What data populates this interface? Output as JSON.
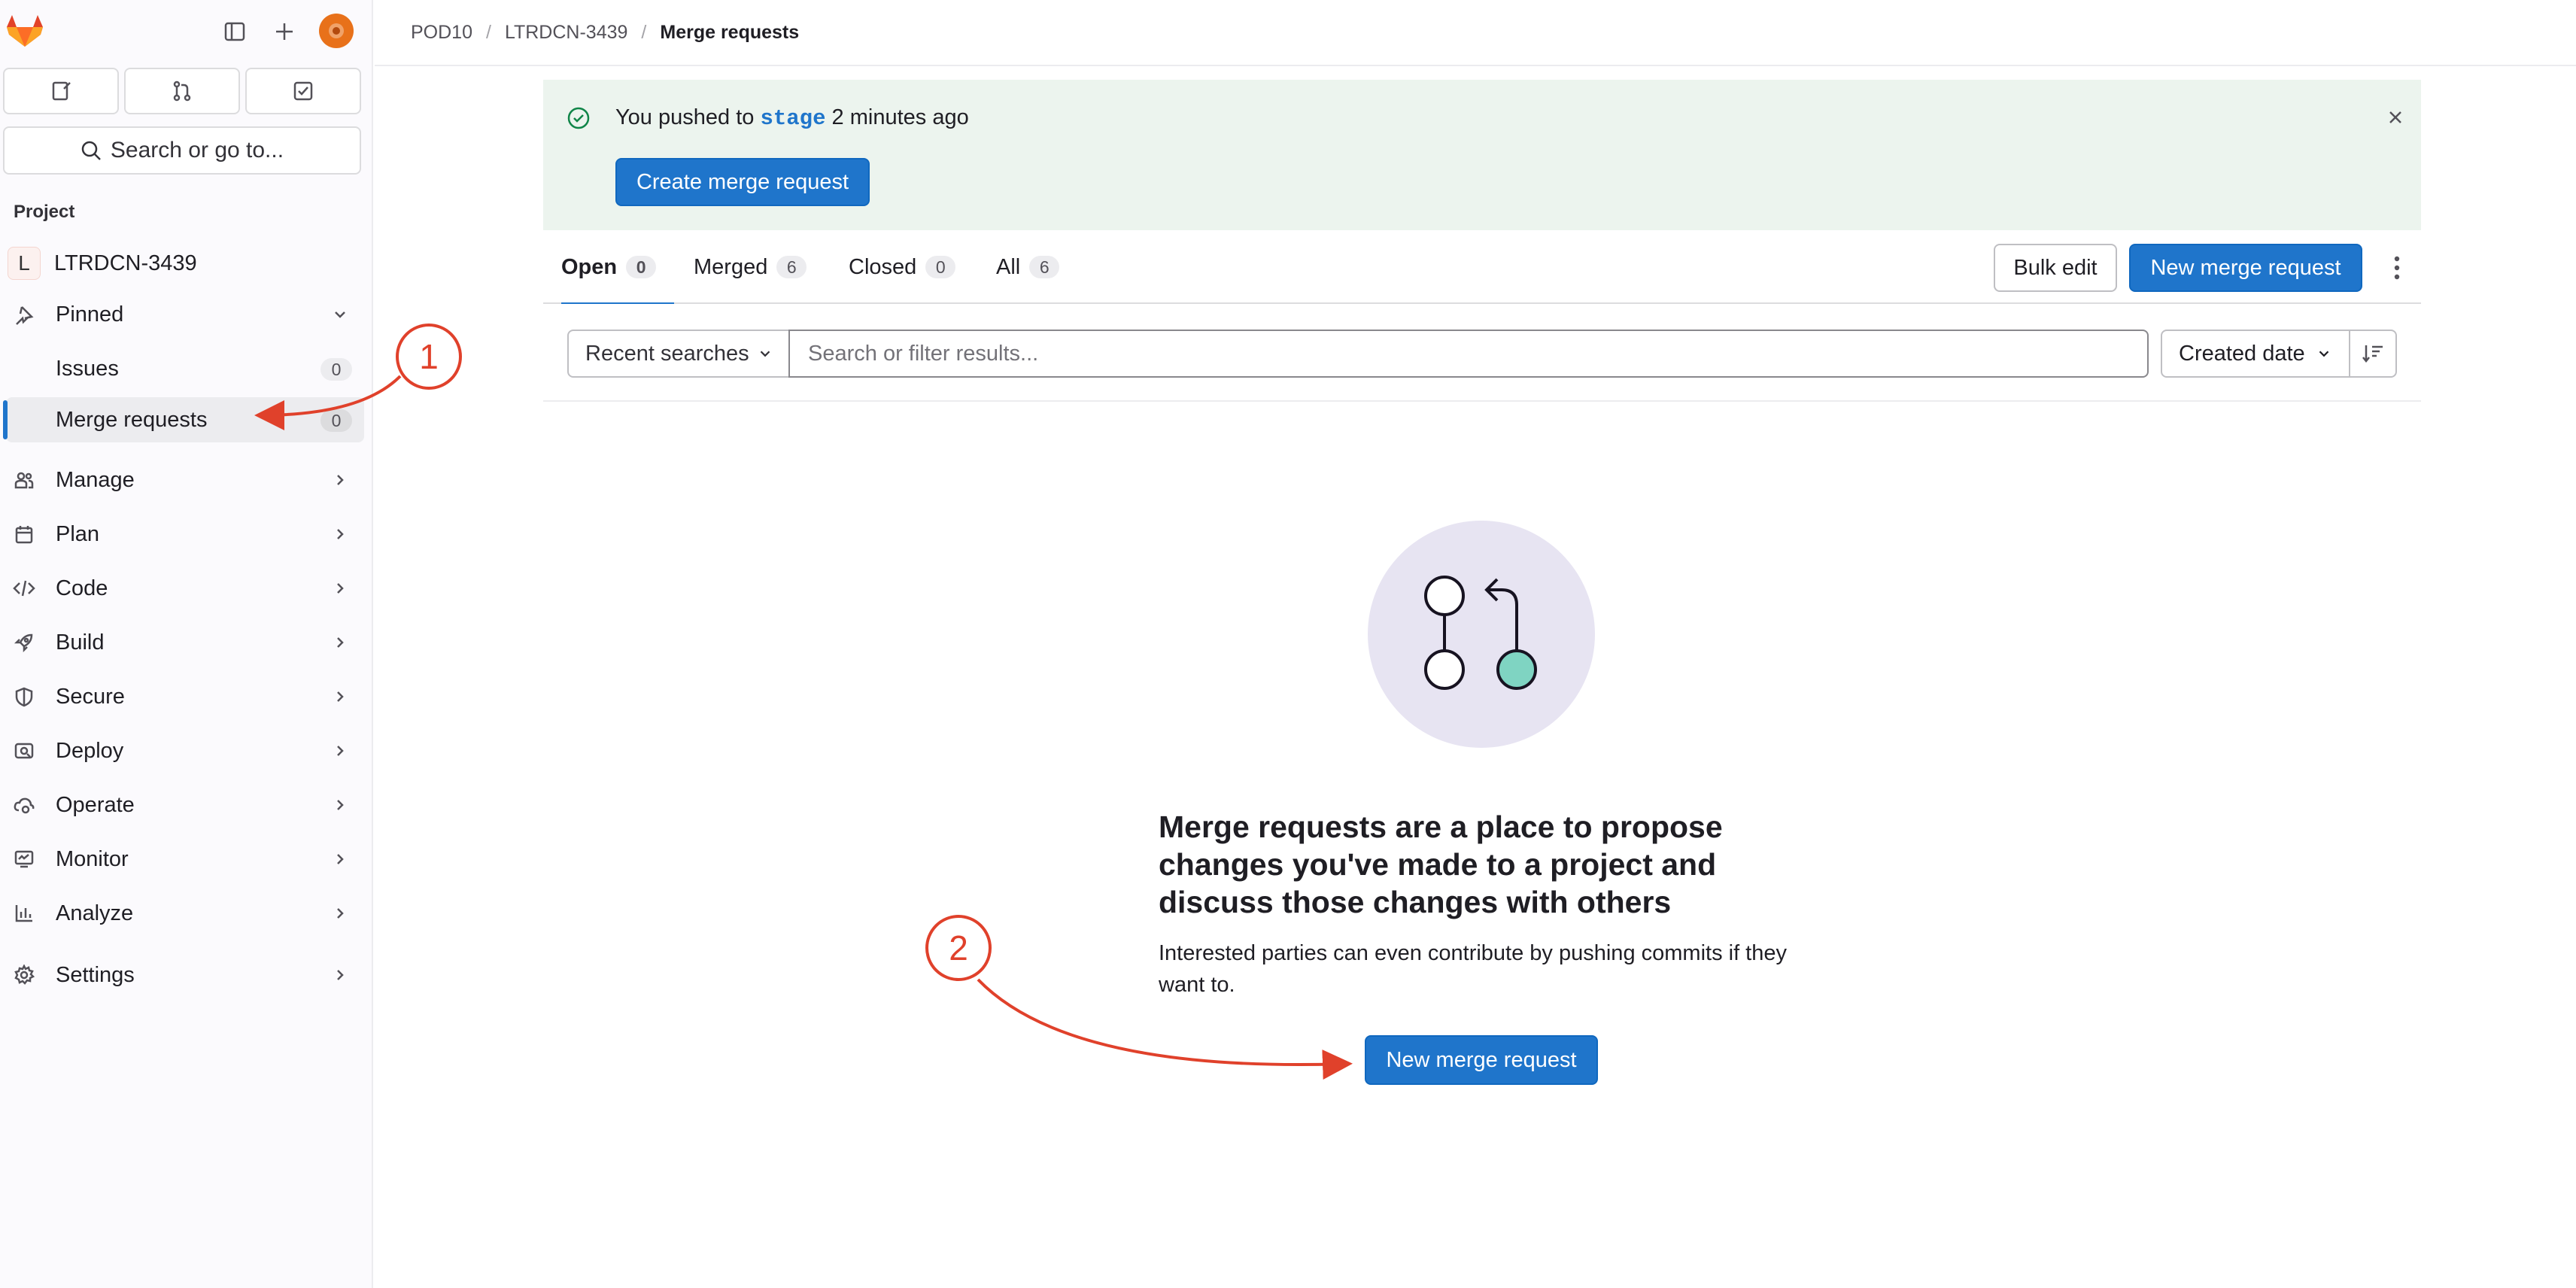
{
  "sidebar": {
    "logo": "gitlab-tanuki-icon",
    "quick_actions": [
      "issues-icon",
      "merge-requests-icon",
      "todos-icon"
    ],
    "search_label": "Search or go to...",
    "section_title": "Project",
    "project": {
      "initial": "L",
      "name": "LTRDCN-3439"
    },
    "pinned": {
      "label": "Pinned",
      "items": [
        {
          "label": "Issues",
          "count": "0"
        },
        {
          "label": "Merge requests",
          "count": "0"
        }
      ]
    },
    "items": [
      {
        "label": "Manage",
        "icon": "users-icon"
      },
      {
        "label": "Plan",
        "icon": "calendar-icon"
      },
      {
        "label": "Code",
        "icon": "code-icon"
      },
      {
        "label": "Build",
        "icon": "rocket-icon"
      },
      {
        "label": "Secure",
        "icon": "shield-icon"
      },
      {
        "label": "Deploy",
        "icon": "deploy-icon"
      },
      {
        "label": "Operate",
        "icon": "cloud-gear-icon"
      },
      {
        "label": "Monitor",
        "icon": "monitor-icon"
      },
      {
        "label": "Analyze",
        "icon": "chart-icon"
      }
    ],
    "settings_label": "Settings"
  },
  "breadcrumb": [
    "POD10",
    "LTRDCN-3439",
    "Merge requests"
  ],
  "alert": {
    "prefix": "You pushed to",
    "branch": "stage",
    "suffix": "2 minutes ago",
    "button": "Create merge request"
  },
  "tabs": [
    {
      "label": "Open",
      "count": "0"
    },
    {
      "label": "Merged",
      "count": "6"
    },
    {
      "label": "Closed",
      "count": "0"
    },
    {
      "label": "All",
      "count": "6"
    }
  ],
  "actions": {
    "bulk_edit": "Bulk edit",
    "new_mr": "New merge request"
  },
  "filter": {
    "recent_label": "Recent searches",
    "placeholder": "Search or filter results...",
    "sort_label": "Created date"
  },
  "empty_state": {
    "title": "Merge requests are a place to propose changes you've made to a project and discuss those changes with others",
    "description": "Interested parties can even contribute by pushing commits if they want to.",
    "button": "New merge request"
  },
  "annotations": [
    "1",
    "2"
  ],
  "colors": {
    "accent": "#1f75cb",
    "annotation": "#e0412b",
    "alert_bg": "#ecf4ee",
    "sidebar_bg": "#fbfafd"
  }
}
